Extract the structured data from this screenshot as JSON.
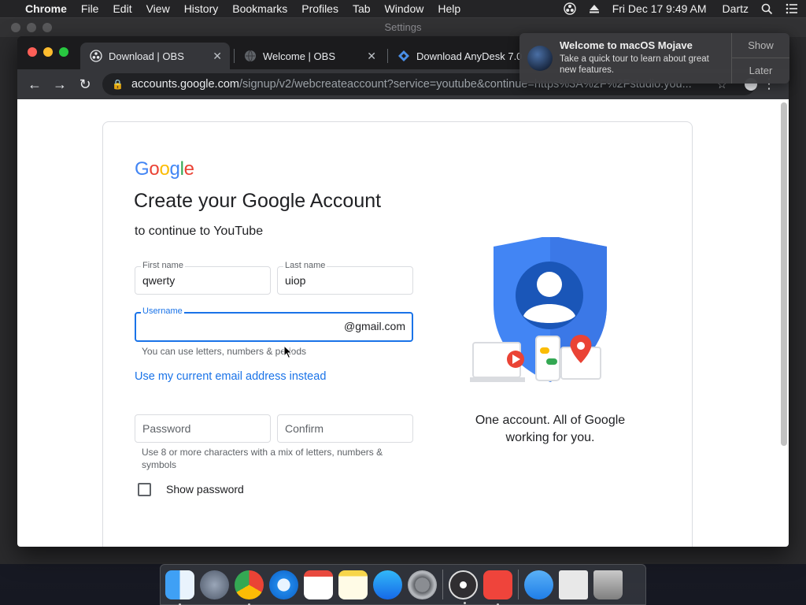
{
  "menubar": {
    "app": "Chrome",
    "items": [
      "File",
      "Edit",
      "View",
      "History",
      "Bookmarks",
      "Profiles",
      "Tab",
      "Window",
      "Help"
    ],
    "clock": "Fri Dec 17  9:49 AM",
    "user": "Dartz"
  },
  "background_window": {
    "title": "Settings"
  },
  "browser": {
    "tabs": [
      {
        "title": "Download | OBS",
        "icon": "obs-icon"
      },
      {
        "title": "Welcome | OBS",
        "icon": "globe-icon"
      },
      {
        "title": "Download AnyDesk 7.0",
        "icon": "anydesk-icon"
      }
    ],
    "url_host": "accounts.google.com",
    "url_path": "/signup/v2/webcreateaccount?service=youtube&continue=https%3A%2F%2Fstudio.you..."
  },
  "notification": {
    "title": "Welcome to macOS Mojave",
    "body": "Take a quick tour to learn about great new features.",
    "show_label": "Show",
    "later_label": "Later"
  },
  "signup": {
    "logo": "Google",
    "heading": "Create your Google Account",
    "subheading": "to continue to YouTube",
    "first_name_label": "First name",
    "first_name_value": "qwerty",
    "last_name_label": "Last name",
    "last_name_value": "uiop",
    "username_label": "Username",
    "username_suffix": "@gmail.com",
    "username_hint": "You can use letters, numbers & periods",
    "use_current_email": "Use my current email address instead",
    "password_placeholder": "Password",
    "confirm_placeholder": "Confirm",
    "password_hint": "Use 8 or more characters with a mix of letters, numbers & symbols",
    "show_password": "Show password",
    "tagline": "One account. All of Google working for you."
  },
  "colors": {
    "google_blue": "#4285F4",
    "google_red": "#EA4335",
    "google_yellow": "#FBBC05",
    "google_green": "#34A853",
    "focus_blue": "#1a73e8"
  }
}
